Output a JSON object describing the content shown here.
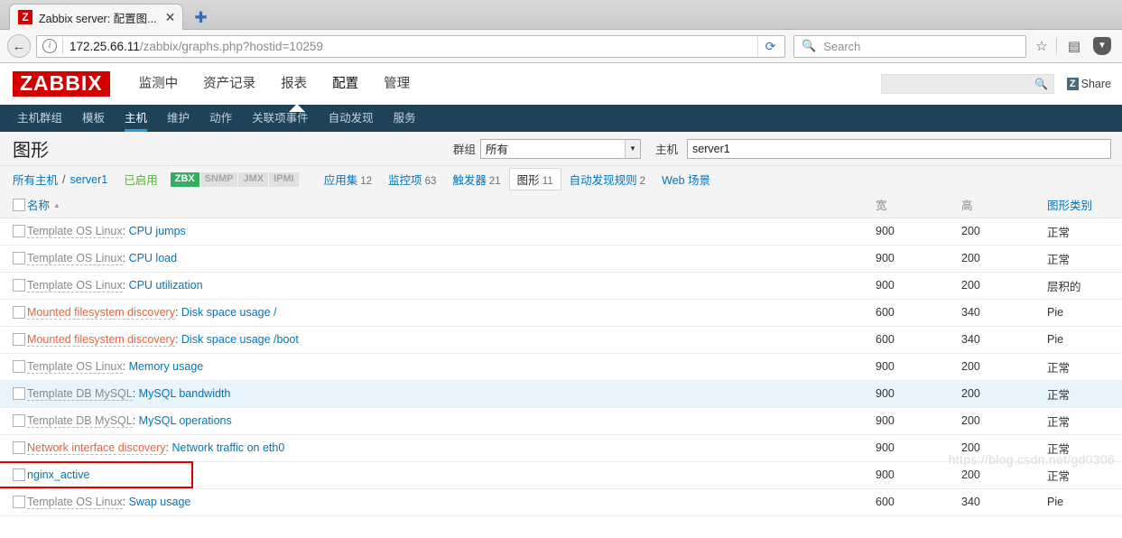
{
  "browser": {
    "tab": {
      "favicon_letter": "Z",
      "title": "Zabbix server: 配置图...",
      "close_label": "✕"
    },
    "new_tab_label": "✚",
    "back_label": "←",
    "url_host": "172.25.66.11",
    "url_path": "/zabbix/graphs.php?hostid=10259",
    "url_full": "172.25.66.11/zabbix/graphs.php?hostid=10259",
    "info_label": "i",
    "reload_label": "⟳",
    "search_placeholder": "Search",
    "search_value": "",
    "bookmark_label": "☆",
    "library_label": "▤",
    "pocket_label": "▼"
  },
  "zabbix": {
    "logo": "ZABBIX",
    "menu": [
      {
        "label": "监测中",
        "active": false
      },
      {
        "label": "资产记录",
        "active": false
      },
      {
        "label": "报表",
        "active": false
      },
      {
        "label": "配置",
        "active": true
      },
      {
        "label": "管理",
        "active": false
      }
    ],
    "global_search": {
      "value": "",
      "placeholder": ""
    },
    "share": {
      "badge": "Z",
      "label": "Share"
    },
    "subnav": [
      {
        "label": "主机群组",
        "active": false
      },
      {
        "label": "模板",
        "active": false
      },
      {
        "label": "主机",
        "active": true
      },
      {
        "label": "维护",
        "active": false
      },
      {
        "label": "动作",
        "active": false
      },
      {
        "label": "关联项事件",
        "active": false
      },
      {
        "label": "自动发现",
        "active": false
      },
      {
        "label": "服务",
        "active": false
      }
    ],
    "page_title": "图形",
    "filter": {
      "group_label": "群组",
      "group_value": "所有",
      "host_label": "主机",
      "host_value": "server1"
    },
    "breadcrumb": {
      "all_hosts": "所有主机",
      "separator": "/",
      "host": "server1",
      "status": "已启用",
      "badges": [
        {
          "label": "ZBX",
          "enabled": true
        },
        {
          "label": "SNMP",
          "enabled": false
        },
        {
          "label": "JMX",
          "enabled": false
        },
        {
          "label": "IPMI",
          "enabled": false
        }
      ],
      "tabs": [
        {
          "label": "应用集",
          "count": "12",
          "selected": false
        },
        {
          "label": "监控项",
          "count": "63",
          "selected": false
        },
        {
          "label": "触发器",
          "count": "21",
          "selected": false
        },
        {
          "label": "图形",
          "count": "11",
          "selected": true
        },
        {
          "label": "自动发现规则",
          "count": "2",
          "selected": false
        },
        {
          "label": "Web 场景",
          "count": "",
          "selected": false
        }
      ]
    },
    "table": {
      "headers": {
        "name": "名称",
        "sort_arrow": "▲",
        "width": "宽",
        "height": "高",
        "type": "图形类别"
      },
      "rows": [
        {
          "prefix": "Template OS Linux",
          "prefix_kind": "template",
          "sep": ":",
          "name": "CPU jumps",
          "width": "900",
          "height": "200",
          "type": "正常",
          "hover": false,
          "marked": false
        },
        {
          "prefix": "Template OS Linux",
          "prefix_kind": "template",
          "sep": ":",
          "name": "CPU load",
          "width": "900",
          "height": "200",
          "type": "正常",
          "hover": false,
          "marked": false
        },
        {
          "prefix": "Template OS Linux",
          "prefix_kind": "template",
          "sep": ":",
          "name": "CPU utilization",
          "width": "900",
          "height": "200",
          "type": "层积的",
          "hover": false,
          "marked": false
        },
        {
          "prefix": "Mounted filesystem discovery",
          "prefix_kind": "discovery",
          "sep": ":",
          "name": "Disk space usage /",
          "width": "600",
          "height": "340",
          "type": "Pie",
          "hover": false,
          "marked": false
        },
        {
          "prefix": "Mounted filesystem discovery",
          "prefix_kind": "discovery",
          "sep": ":",
          "name": "Disk space usage /boot",
          "width": "600",
          "height": "340",
          "type": "Pie",
          "hover": false,
          "marked": false
        },
        {
          "prefix": "Template OS Linux",
          "prefix_kind": "template",
          "sep": ":",
          "name": "Memory usage",
          "width": "900",
          "height": "200",
          "type": "正常",
          "hover": false,
          "marked": false
        },
        {
          "prefix": "Template DB MySQL",
          "prefix_kind": "template",
          "sep": ":",
          "name": "MySQL bandwidth",
          "width": "900",
          "height": "200",
          "type": "正常",
          "hover": true,
          "marked": false
        },
        {
          "prefix": "Template DB MySQL",
          "prefix_kind": "template",
          "sep": ":",
          "name": "MySQL operations",
          "width": "900",
          "height": "200",
          "type": "正常",
          "hover": false,
          "marked": false
        },
        {
          "prefix": "Network interface discovery",
          "prefix_kind": "discovery",
          "sep": ":",
          "name": "Network traffic on eth0",
          "width": "900",
          "height": "200",
          "type": "正常",
          "hover": false,
          "marked": false
        },
        {
          "prefix": "",
          "prefix_kind": "none",
          "sep": "",
          "name": "nginx_active",
          "width": "900",
          "height": "200",
          "type": "正常",
          "hover": false,
          "marked": true
        },
        {
          "prefix": "Template OS Linux",
          "prefix_kind": "template",
          "sep": ":",
          "name": "Swap usage",
          "width": "600",
          "height": "340",
          "type": "Pie",
          "hover": false,
          "marked": false
        }
      ]
    }
  },
  "watermark": "https://blog.csdn.net/gd0306",
  "colors": {
    "brand_red": "#d40000",
    "subnav_bg": "#1f4257",
    "link_blue": "#0275b8",
    "accent_blue": "#2e9ada",
    "discovery_orange": "#e8633a",
    "enabled_green": "#5aac44",
    "badge_green": "#34ae61",
    "mark_red": "#e10000",
    "row_hover": "#e8f4fb"
  }
}
